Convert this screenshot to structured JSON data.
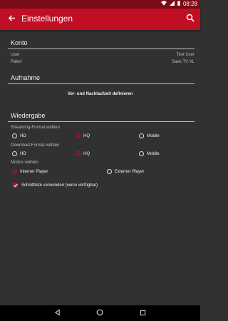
{
  "status_bar": {
    "time": "08:28"
  },
  "app_bar": {
    "title": "Einstellungen"
  },
  "konto": {
    "title": "Konto",
    "rows": [
      {
        "label": "User",
        "value": "Test User"
      },
      {
        "label": "Paket",
        "value": "Save.TV XL"
      }
    ]
  },
  "aufnahme": {
    "title": "Aufnahme",
    "link": "Vor- und Nachlaufzeit definieren"
  },
  "wiedergabe": {
    "title": "Wiedergabe",
    "streaming_label": "Streaming-Format wählen",
    "streaming_options": [
      "HD",
      "HQ",
      "Mobile"
    ],
    "streaming_selected": "HQ",
    "download_label": "Download-Format wählen",
    "download_options": [
      "HD",
      "HQ",
      "Mobile"
    ],
    "download_selected": "HQ",
    "modus_label": "Modus wählen",
    "modus_options": [
      "Interner Player",
      "Externer Player"
    ],
    "modus_selected": "Interner Player",
    "checkbox_label": "Schnittliste verwenden (wenn verfügbar)",
    "checkbox_checked": true
  },
  "colors": {
    "accent": "#c20e24",
    "status_bar": "#7a0c18",
    "background": "#313131"
  }
}
